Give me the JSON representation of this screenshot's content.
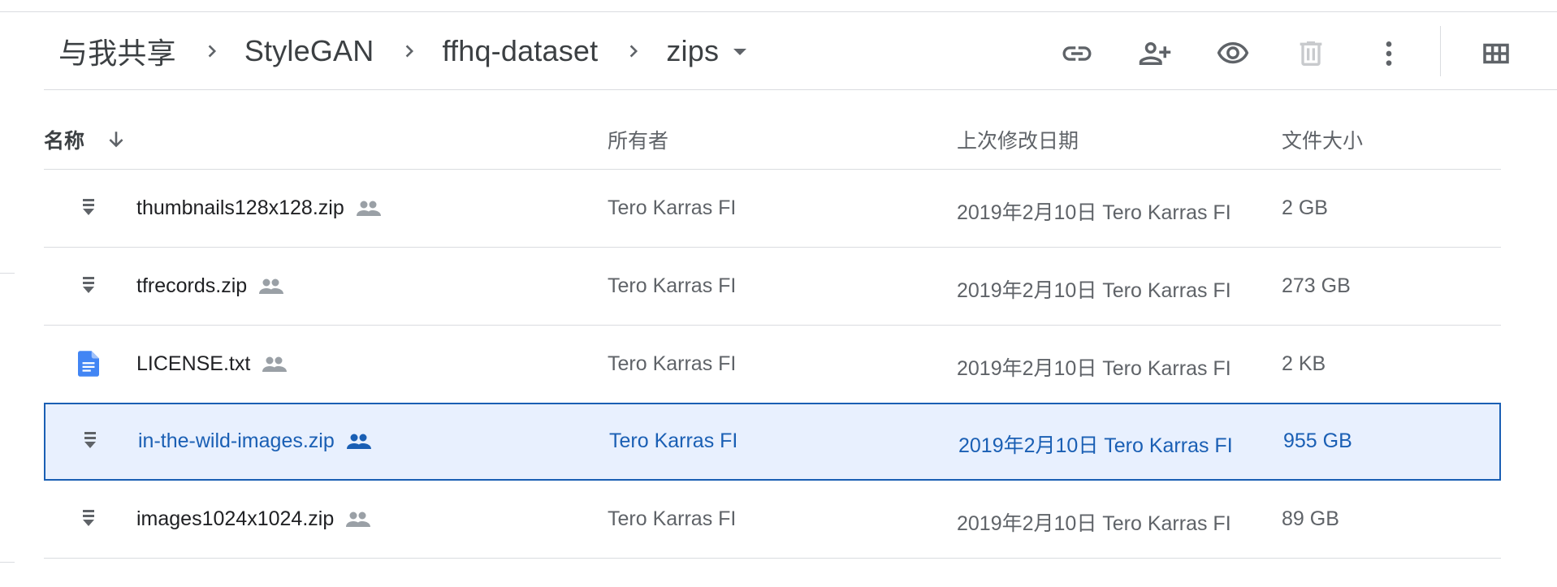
{
  "breadcrumb": {
    "items": [
      "与我共享",
      "StyleGAN",
      "ffhq-dataset",
      "zips"
    ]
  },
  "toolbar": {
    "icons": [
      "link-icon",
      "add-person-icon",
      "preview-icon",
      "trash-icon",
      "more-vert-icon",
      "grid-view-icon"
    ]
  },
  "table": {
    "headers": {
      "name": "名称",
      "owner": "所有者",
      "modified": "上次修改日期",
      "size": "文件大小"
    },
    "rows": [
      {
        "name": "thumbnails128x128.zip",
        "type": "zip",
        "owner": "Tero Karras FI",
        "modified": "2019年2月10日  Tero Karras FI",
        "size": "2 GB",
        "selected": false
      },
      {
        "name": "tfrecords.zip",
        "type": "zip",
        "owner": "Tero Karras FI",
        "modified": "2019年2月10日  Tero Karras FI",
        "size": "273 GB",
        "selected": false
      },
      {
        "name": "LICENSE.txt",
        "type": "doc",
        "owner": "Tero Karras FI",
        "modified": "2019年2月10日  Tero Karras FI",
        "size": "2 KB",
        "selected": false
      },
      {
        "name": "in-the-wild-images.zip",
        "type": "zip",
        "owner": "Tero Karras FI",
        "modified": "2019年2月10日  Tero Karras FI",
        "size": "955 GB",
        "selected": true
      },
      {
        "name": "images1024x1024.zip",
        "type": "zip",
        "owner": "Tero Karras FI",
        "modified": "2019年2月10日  Tero Karras FI",
        "size": "89 GB",
        "selected": false
      }
    ]
  },
  "colors": {
    "selected_bg": "#e8f0fe",
    "selected_accent": "#1a5fb4",
    "doc_icon": "#4285f4"
  }
}
